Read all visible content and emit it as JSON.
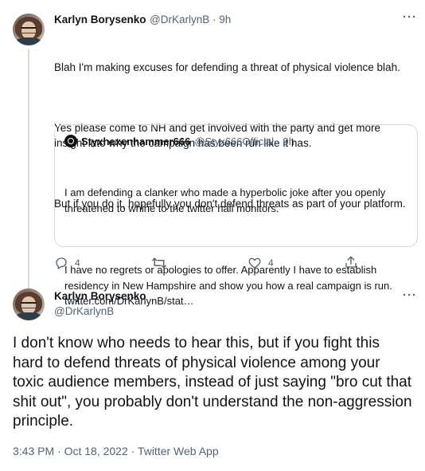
{
  "tweet1": {
    "name": "Karlyn Borysenko",
    "handle_time": "@DrKarlynB · 9h",
    "more": "···",
    "paragraphs": [
      "Blah I'm making excuses for defending a threat of physical violence blah.",
      "Yes please come to NH and get involved with the party and get more insight into why the campaign has been run like it has.",
      "But if you do it, hopefully you don't defend threats as part of your platform."
    ],
    "quote": {
      "name": "Styxhexenhammer666",
      "handle_time": "@Styx666Official · 9h",
      "paragraphs": [
        "I am defending a clanker who made a hyperbolic joke after you openly threatened to whine to the twitter hall monitors.",
        "I have no regrets or apologies to offer. Apparently I have to establish residency in New Hampshire and show you how a real campaign is run.\ntwitter.com/DrKarlynB/stat…"
      ]
    },
    "actions": {
      "reply_count": "4",
      "retweet_count": "",
      "like_count": "4",
      "share_icon": "share-icon"
    }
  },
  "tweet2": {
    "name": "Karlyn Borysenko",
    "handle": "@DrKarlynB",
    "more": "···",
    "text": "I don't know who needs to hear this, but if you fight this hard to defend threats of physical violence among your toxic audience members, instead of just saying \"bro cut that shit out\", you probably don't understand the non-aggression principle.",
    "timestamp": "3:43 PM · Oct 18, 2022 · Twitter Web App"
  }
}
